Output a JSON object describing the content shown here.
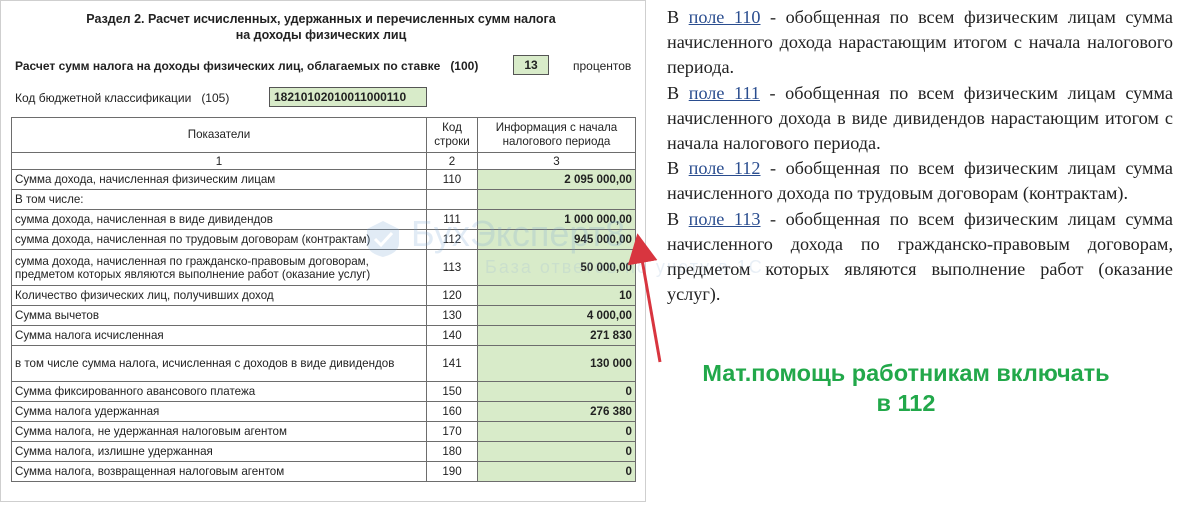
{
  "form": {
    "title_line1": "Раздел 2. Расчет исчисленных, удержанных и перечисленных сумм налога",
    "title_line2": "на доходы физических лиц",
    "rate_label": "Расчет сумм налога на доходы физических лиц, облагаемых по ставке",
    "rate_code": "(100)",
    "rate_value": "13",
    "rate_unit": "процентов",
    "kbk_label": "Код бюджетной классификации",
    "kbk_code": "(105)",
    "kbk_value": "18210102010011000110",
    "table": {
      "headers": [
        "Показатели",
        "Код строки",
        "Информация с начала налогового периода"
      ],
      "col_numbers": [
        "1",
        "2",
        "3"
      ],
      "rows": [
        {
          "label": "Сумма дохода, начисленная физическим лицам",
          "code": "110",
          "value": "2 095 000,00"
        },
        {
          "label": "В том числе:",
          "code": "",
          "value": ""
        },
        {
          "label": "сумма дохода, начисленная в виде дивидендов",
          "code": "111",
          "value": "1 000 000,00"
        },
        {
          "label": "сумма дохода, начисленная по трудовым договорам (контрактам)",
          "code": "112",
          "value": "945 000,00"
        },
        {
          "label": "сумма дохода, начисленная по гражданско-правовым договорам, предметом которых являются выполнение работ (оказание услуг)",
          "code": "113",
          "value": "50 000,00"
        },
        {
          "label": "Количество физических лиц, получивших доход",
          "code": "120",
          "value": "10"
        },
        {
          "label": "Сумма вычетов",
          "code": "130",
          "value": "4 000,00"
        },
        {
          "label": "Сумма налога исчисленная",
          "code": "140",
          "value": "271 830"
        },
        {
          "label": "в том числе сумма налога, исчисленная с доходов в виде дивидендов",
          "code": "141",
          "value": "130 000"
        },
        {
          "label": "Сумма фиксированного авансового платежа",
          "code": "150",
          "value": "0"
        },
        {
          "label": "Сумма налога удержанная",
          "code": "160",
          "value": "276 380"
        },
        {
          "label": "Сумма налога, не удержанная налоговым агентом",
          "code": "170",
          "value": "0"
        },
        {
          "label": "Сумма налога, излишне удержанная",
          "code": "180",
          "value": "0"
        },
        {
          "label": "Сумма налога, возвращенная налоговым агентом",
          "code": "190",
          "value": "0"
        }
      ]
    }
  },
  "watermark": {
    "title": "БухЭксперт8",
    "subtitle": "База ответов по учету в 1С"
  },
  "explanations": [
    {
      "prefix": "В ",
      "link": "поле 110",
      "text": " - обобщенная по всем физическим лицам сумма начисленного дохода нарастающим итогом с начала налогового периода."
    },
    {
      "prefix": "В ",
      "link": "поле 111",
      "text": " - обобщенная по всем физическим лицам сумма начисленного дохода в виде дивидендов нарастающим итогом с начала налогового периода."
    },
    {
      "prefix": "В ",
      "link": "поле 112",
      "text": " - обобщенная по всем физическим лицам сумма начисленного дохода по трудовым договорам (контрактам)."
    },
    {
      "prefix": "В ",
      "link": "поле 113",
      "text": " - обобщенная по всем физическим лицам сумма начисленного дохода по гражданско-правовым договорам, предметом которых являются выполнение работ (оказание услуг)."
    }
  ],
  "note": {
    "line1": "Мат.помощь работникам включать",
    "line2": "в 112"
  },
  "colors": {
    "field_fill": "#d8ebc9",
    "note_green": "#22a84a",
    "arrow_red": "#d8353f",
    "link_blue": "#2a4d8f"
  }
}
